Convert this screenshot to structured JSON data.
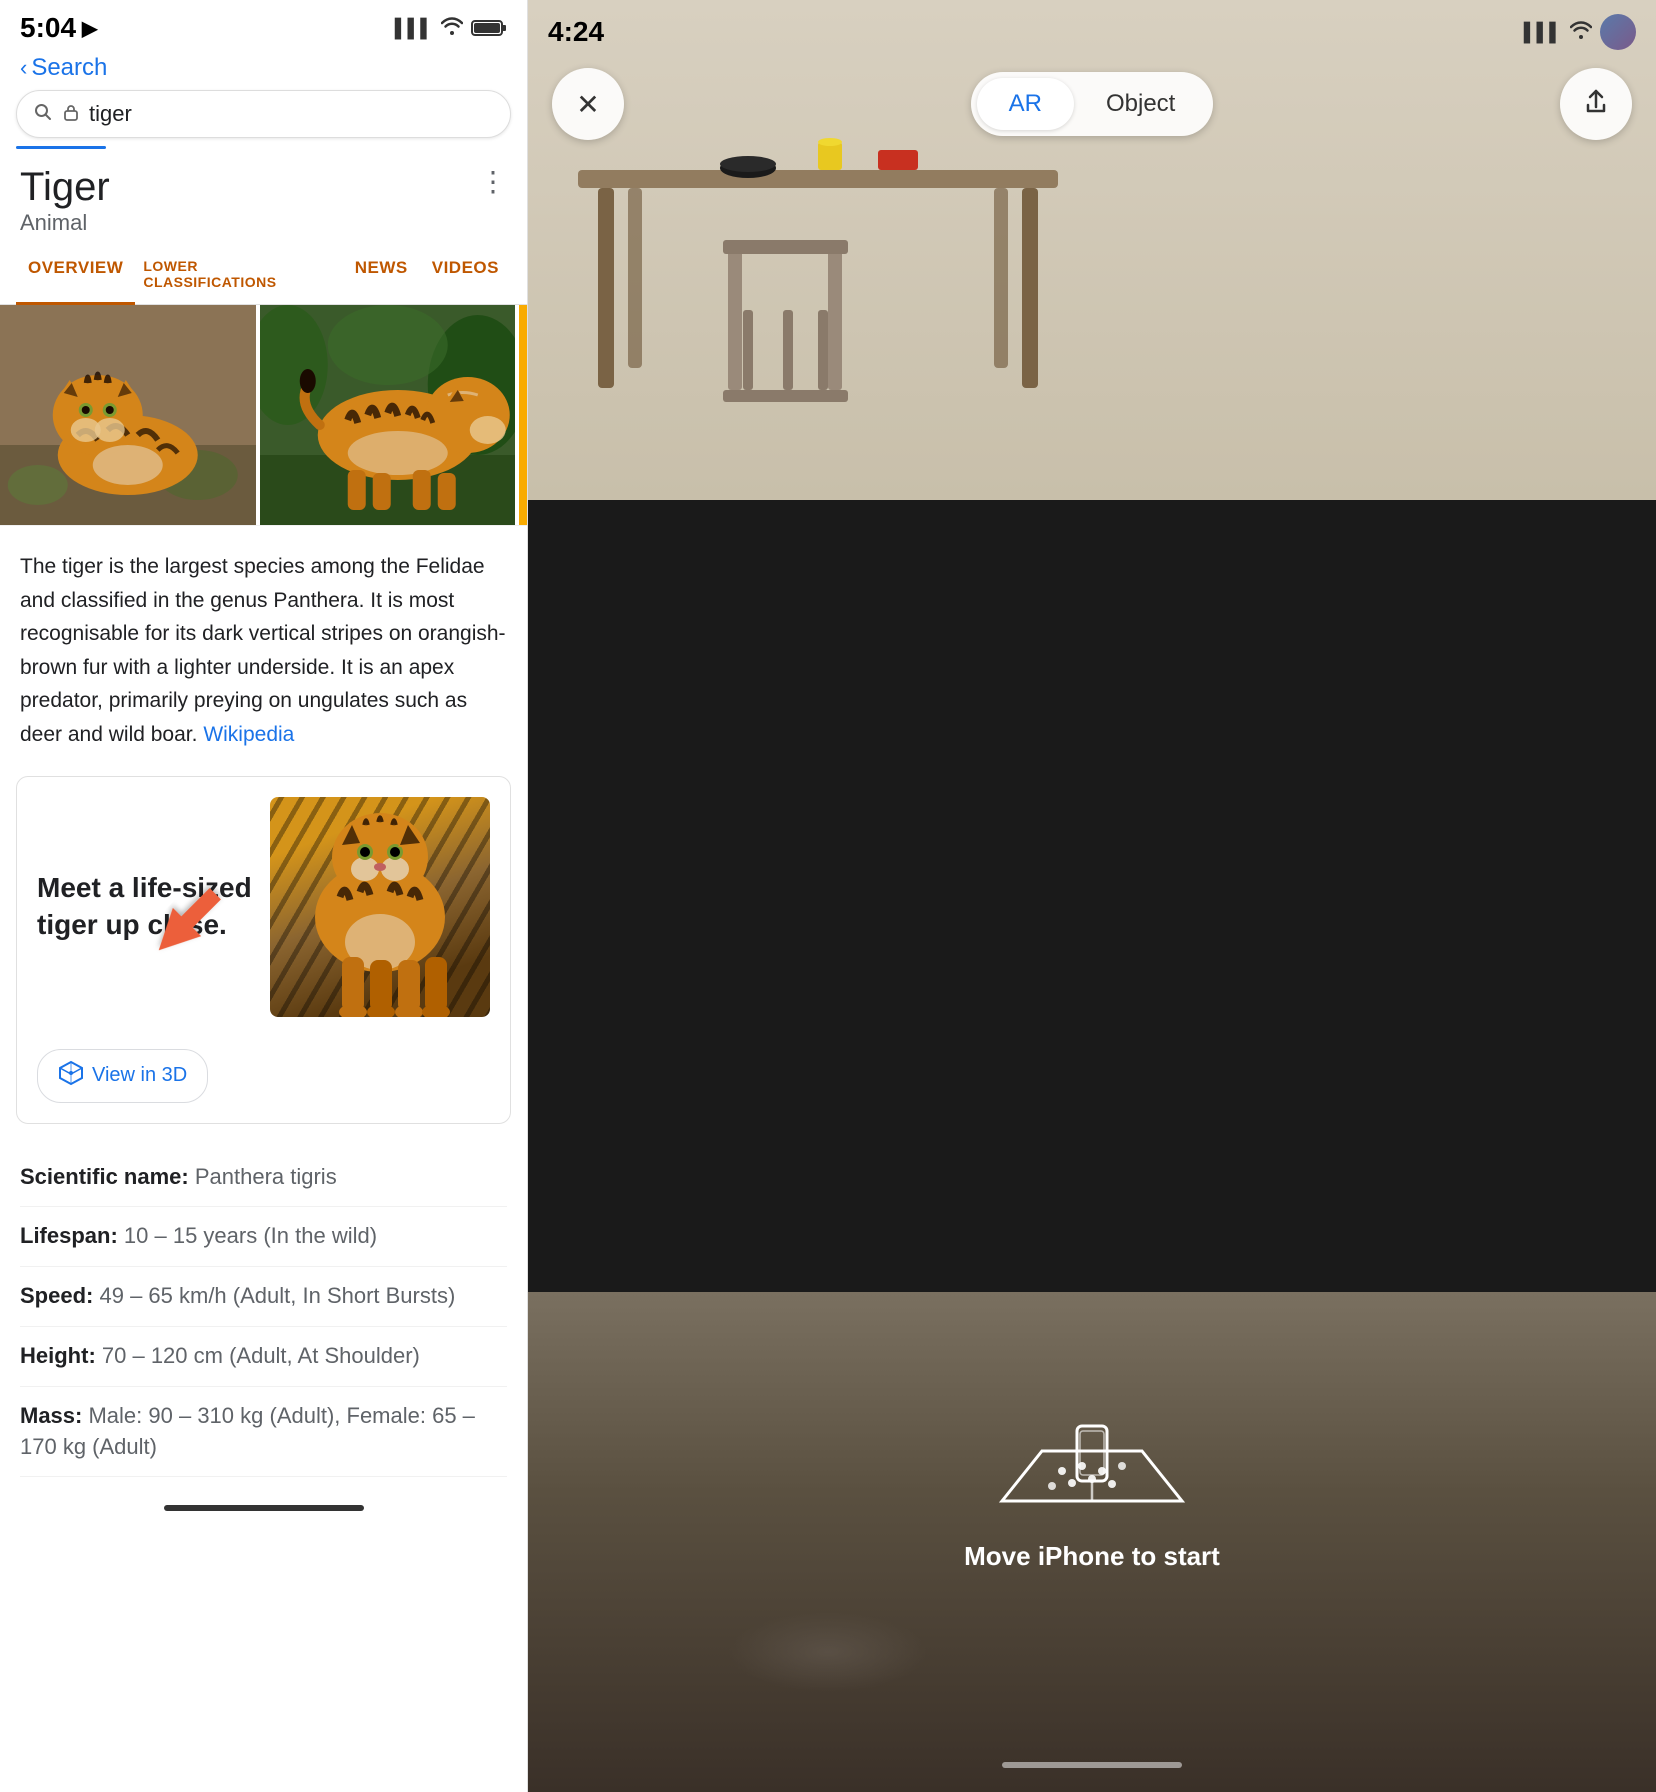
{
  "left": {
    "statusBar": {
      "time": "5:04",
      "locationArrow": "▶",
      "signalIcon": "📶",
      "wifiIcon": "WiFi",
      "batteryIcon": "🔋"
    },
    "backNav": {
      "arrow": "‹",
      "label": "Search"
    },
    "searchBar": {
      "searchIcon": "🔍",
      "lockIcon": "🔒",
      "query": "tiger"
    },
    "title": "Tiger",
    "subtitle": "Animal",
    "moreIcon": "⋮",
    "tabs": [
      {
        "label": "OVERVIEW",
        "active": true
      },
      {
        "label": "LOWER CLASSIFICATIONS",
        "active": false
      },
      {
        "label": "NEWS",
        "active": false
      },
      {
        "label": "VIDEOS",
        "active": false
      }
    ],
    "description": "The tiger is the largest species among the Felidae and classified in the genus Panthera. It is most recognisable for its dark vertical stripes on orangish-brown fur with a lighter underside. It is an apex predator, primarily preying on ungulates such as deer and wild boar.",
    "wikiLink": "Wikipedia",
    "card3d": {
      "title": "Meet a life-sized tiger up close.",
      "viewBtn": "View in 3D",
      "cubeIcon": "⊛"
    },
    "facts": [
      {
        "label": "Scientific name:",
        "value": " Panthera tigris"
      },
      {
        "label": "Lifespan:",
        "value": " 10 – 15 years (In the wild)"
      },
      {
        "label": "Speed:",
        "value": " 49 – 65 km/h (Adult, In Short Bursts)"
      },
      {
        "label": "Height:",
        "value": " 70 – 120 cm (Adult, At Shoulder)"
      },
      {
        "label": "Mass:",
        "value": " Male: 90 – 310 kg (Adult), Female: 65 – 170 kg (Adult)"
      }
    ]
  },
  "right": {
    "statusBar": {
      "time": "4:24"
    },
    "controls": {
      "closeLabel": "✕",
      "arLabel": "AR",
      "objectLabel": "Object",
      "shareLabel": "↑"
    },
    "instruction": "Move iPhone to start",
    "activeTab": "AR"
  }
}
